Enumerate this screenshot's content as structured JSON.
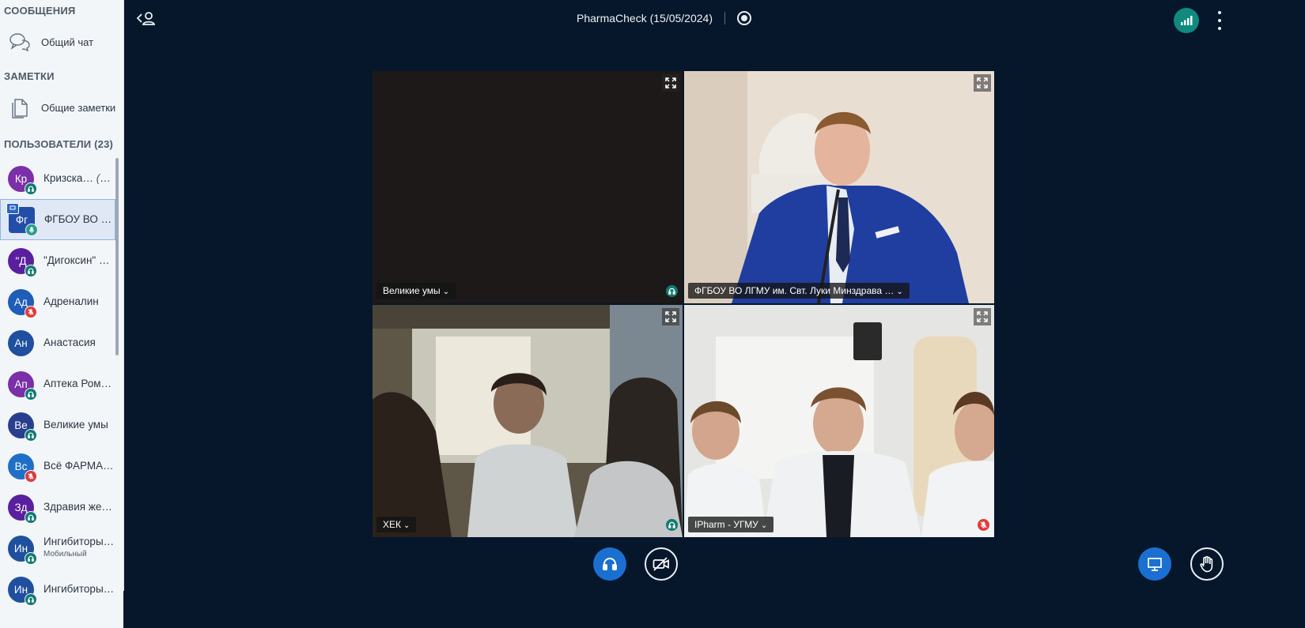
{
  "sidebar": {
    "messages_header": "СООБЩЕНИЯ",
    "public_chat": "Общий чат",
    "notes_header": "ЗАМЕТКИ",
    "shared_notes": "Общие заметки",
    "users_header": "ПОЛЬЗОВАТЕЛИ",
    "users_count": "(23)",
    "users": [
      {
        "initials": "Кр",
        "name": "Кризска…",
        "you": "(Вы)",
        "color": "#7b2fa8",
        "status": "listen"
      },
      {
        "initials": "Фг",
        "name": "ФГБОУ ВО Л…",
        "color": "#234ea8",
        "status": "talk",
        "presenter": true
      },
      {
        "initials": "\"Д",
        "name": "\"Дигоксин\" …",
        "color": "#5a1f9e",
        "status": "listen"
      },
      {
        "initials": "Ад",
        "name": "Адреналин",
        "color": "#1e5db8",
        "status": "muted"
      },
      {
        "initials": "Ан",
        "name": "Анастасия",
        "color": "#1f4f9f",
        "status": "none"
      },
      {
        "initials": "Ап",
        "name": "Аптека Ром…",
        "color": "#7b2fa8",
        "status": "listen"
      },
      {
        "initials": "Ве",
        "name": "Великие умы",
        "color": "#2a3e8f",
        "status": "listen"
      },
      {
        "initials": "Вс",
        "name": "Всё ФАРМА…",
        "color": "#1f6fc7",
        "status": "muted"
      },
      {
        "initials": "Зд",
        "name": "Здравия же…",
        "color": "#5a1f9e",
        "status": "listen"
      },
      {
        "initials": "Ин",
        "name": "Ингибиторы …",
        "sub": "Мобильный",
        "color": "#1f4f9f",
        "status": "listen"
      },
      {
        "initials": "Ин",
        "name": "Ингибиторы …",
        "color": "#1f4f9f",
        "status": "listen"
      }
    ]
  },
  "header": {
    "title": "PharmaCheck (15/05/2024)"
  },
  "videos": [
    {
      "label": "Великие умы",
      "status": "listen"
    },
    {
      "label": "ФГБОУ ВО ЛГМУ им. Свт. Луки Минздрава …",
      "status": "none"
    },
    {
      "label": "ХЕК",
      "status": "listen"
    },
    {
      "label": "IPharm - УГМУ",
      "status": "muted"
    }
  ],
  "colors": {
    "background": "#06172b",
    "accent": "#1b6fd1",
    "connection": "#0f8a7e",
    "muted": "#e03b3b",
    "listen": "#117b72"
  },
  "icons": {
    "toggle": "user-list-toggle-icon",
    "record": "record-icon",
    "connection": "connection-status-icon",
    "more": "more-options-icon",
    "audio": "headphones-icon",
    "camera": "camera-off-icon",
    "presentation": "presentation-icon",
    "hand": "raise-hand-icon"
  }
}
